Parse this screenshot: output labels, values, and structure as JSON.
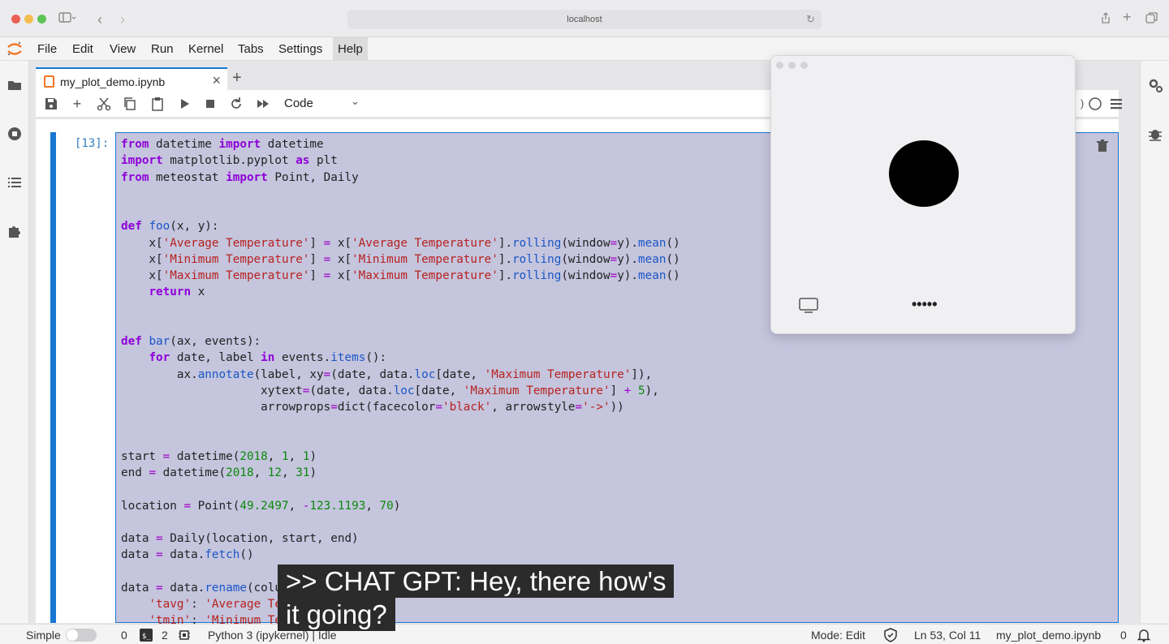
{
  "browser": {
    "url": "localhost"
  },
  "menu": [
    "File",
    "Edit",
    "View",
    "Run",
    "Kernel",
    "Tabs",
    "Settings",
    "Help"
  ],
  "tab": {
    "title": "my_plot_demo.ipynb"
  },
  "toolbar": {
    "cell_type": "Code"
  },
  "cell": {
    "prompt": "[13]:",
    "code": [
      "from datetime import datetime",
      "import matplotlib.pyplot as plt",
      "from meteostat import Point, Daily",
      "",
      "",
      "def foo(x, y):",
      "    x['Average Temperature'] = x['Average Temperature'].rolling(window=y).mean()",
      "    x['Minimum Temperature'] = x['Minimum Temperature'].rolling(window=y).mean()",
      "    x['Maximum Temperature'] = x['Maximum Temperature'].rolling(window=y).mean()",
      "    return x",
      "",
      "",
      "def bar(ax, events):",
      "    for date, label in events.items():",
      "        ax.annotate(label, xy=(date, data.loc[date, 'Maximum Temperature']),",
      "                    xytext=(date, data.loc[date, 'Maximum Temperature'] + 5),",
      "                    arrowprops=dict(facecolor='black', arrowstyle='->'))",
      "",
      "",
      "start = datetime(2018, 1, 1)",
      "end = datetime(2018, 12, 31)",
      "",
      "location = Point(49.2497, -123.1193, 70)",
      "",
      "data = Daily(location, start, end)",
      "data = data.fetch()",
      "",
      "data = data.rename(columns={",
      "    'tavg': 'Average Temperature',",
      "    'tmin': 'Minimum Temperature',"
    ]
  },
  "floating_window": {
    "dots_label": "•••••"
  },
  "status": {
    "mode_label": "Simple",
    "terminals": "0",
    "kernels": "2",
    "kernel": "Python 3 (ipykernel) | Idle",
    "mode": "Mode: Edit",
    "cursor": "Ln 53, Col 11",
    "file": "my_plot_demo.ipynb",
    "notifications": "0"
  },
  "captions": {
    "line1": ">> CHAT GPT: Hey, there how's",
    "line2": "it going?"
  }
}
